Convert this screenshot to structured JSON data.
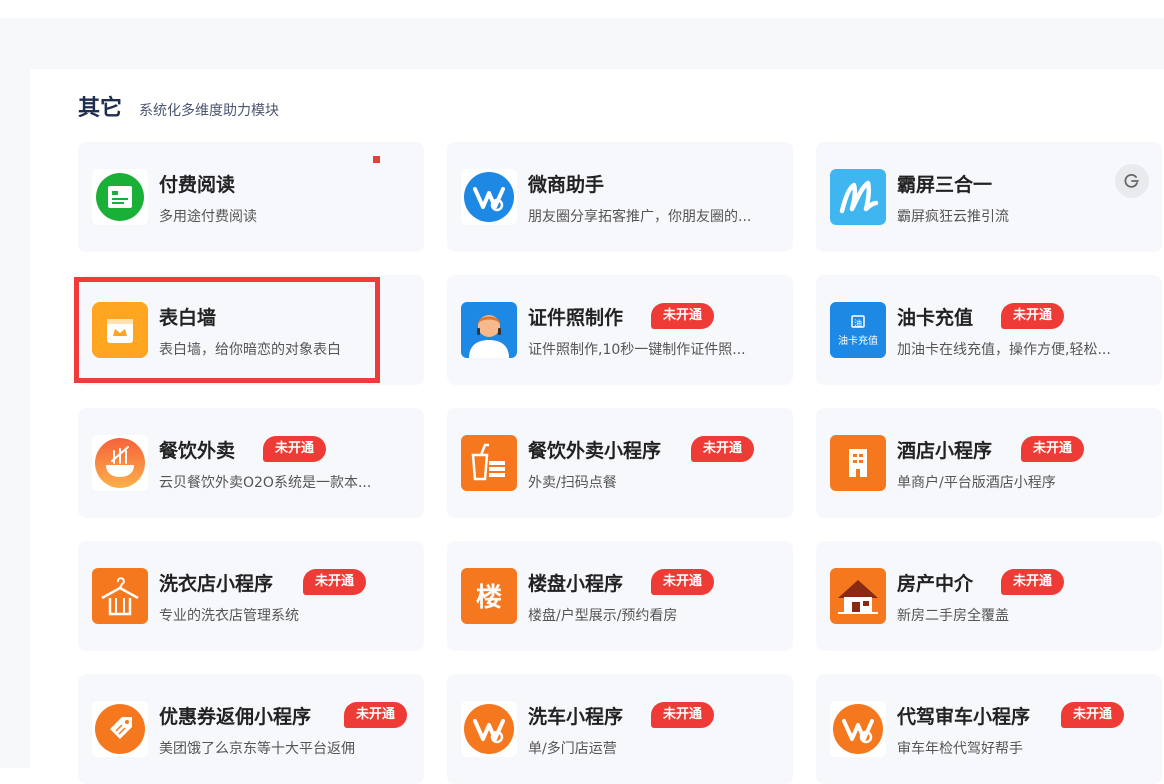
{
  "section": {
    "title": "其它",
    "subtitle": "系统化多维度助力模块"
  },
  "badge_label": "未开通",
  "cards": [
    {
      "title": "付费阅读",
      "desc": "多用途付费阅读",
      "icon": "paid-reading-icon",
      "badge": false
    },
    {
      "title": "微商助手",
      "desc": "朋友圈分享拓客推广，你朋友圈的...",
      "icon": "wechat-business-icon",
      "badge": false
    },
    {
      "title": "霸屏三合一",
      "desc": "霸屏疯狂云推引流",
      "icon": "screen-m-icon",
      "badge": false
    },
    {
      "title": "表白墙",
      "desc": "表白墙，给你暗恋的对象表白",
      "icon": "confession-wall-icon",
      "badge": false
    },
    {
      "title": "证件照制作",
      "desc": "证件照制作,10秒一键制作证件照...",
      "icon": "id-photo-icon",
      "badge": true
    },
    {
      "title": "油卡充值",
      "desc": "加油卡在线充值，操作方便,轻松...",
      "icon": "fuel-card-icon",
      "badge": true,
      "icon_text": "油卡充值"
    },
    {
      "title": "餐饮外卖",
      "desc": "云贝餐饮外卖O2O系统是一款本...",
      "icon": "noodle-bowl-icon",
      "badge": true
    },
    {
      "title": "餐饮外卖小程序",
      "desc": "外卖/扫码点餐",
      "icon": "takeout-drink-icon",
      "badge": true
    },
    {
      "title": "酒店小程序",
      "desc": "单商户/平台版酒店小程序",
      "icon": "hotel-building-icon",
      "badge": true
    },
    {
      "title": "洗衣店小程序",
      "desc": "专业的洗衣店管理系统",
      "icon": "clothes-hanger-icon",
      "badge": true
    },
    {
      "title": "楼盘小程序",
      "desc": "楼盘/户型展示/预约看房",
      "icon": "building-char-icon",
      "badge": true,
      "icon_text": "楼"
    },
    {
      "title": "房产中介",
      "desc": "新房二手房全覆盖",
      "icon": "house-icon",
      "badge": true
    },
    {
      "title": "优惠券返佣小程序",
      "desc": "美团饿了么京东等十大平台返佣",
      "icon": "coupon-tag-icon",
      "badge": true
    },
    {
      "title": "洗车小程序",
      "desc": "单/多门店运营",
      "icon": "orange-logo-icon",
      "badge": true
    },
    {
      "title": "代驾审车小程序",
      "desc": "审车年检代驾好帮手",
      "icon": "orange-logo-icon",
      "badge": true
    }
  ],
  "colors": {
    "badge": "#ee3b36",
    "highlight": "#ee3b3b",
    "orange": "#f5781f",
    "blue": "#1e88e5"
  }
}
